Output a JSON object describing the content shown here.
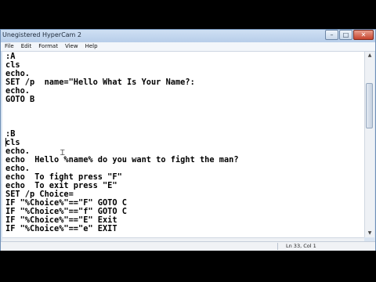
{
  "window": {
    "title": "Unegistered HyperCam 2",
    "buttons": {
      "minimize": "–",
      "maximize": "□",
      "close": "✕"
    }
  },
  "menu": {
    "items": [
      "File",
      "Edit",
      "Format",
      "View",
      "Help"
    ]
  },
  "editor": {
    "lines": [
      ":A",
      "cls",
      "echo.",
      "SET /p  name=\"Hello What Is Your Name?:",
      "echo.",
      "GOTO B",
      "",
      "",
      "",
      ":B",
      "cls",
      "echo.",
      "echo  Hello %name% do you want to fight the man?",
      "echo.",
      "echo  To fight press \"F\"",
      "echo  To exit press \"E\"",
      "SET /p Choice=",
      "IF \"%Choice%\"==\"F\" GOTO C",
      "IF \"%Choice%\"==\"f\" GOTO C",
      "IF \"%Choice%\"==\"E\" Exit",
      "IF \"%Choice%\"==\"e\" EXIT"
    ]
  },
  "status": {
    "position": "Ln 33, Col 1"
  }
}
